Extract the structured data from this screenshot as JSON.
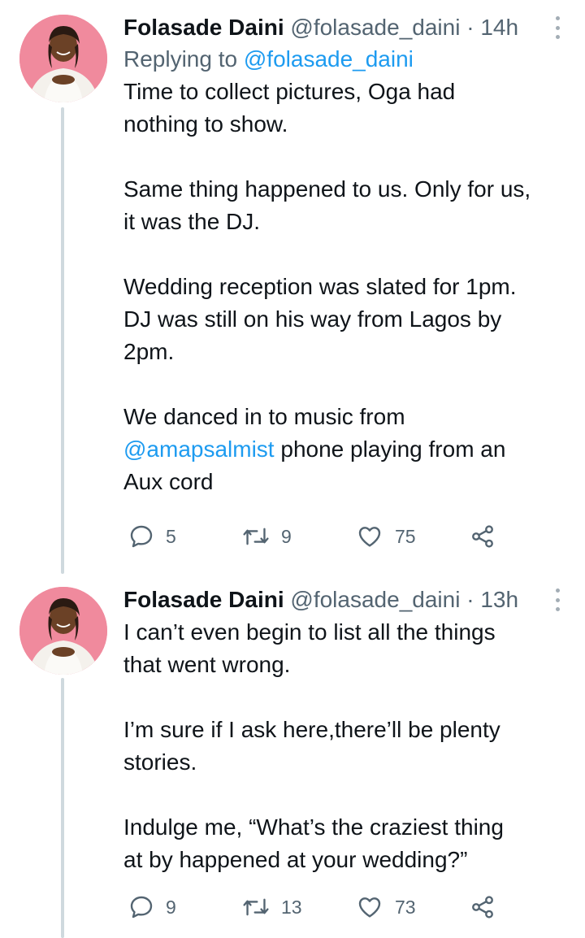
{
  "colors": {
    "link": "#1d9bf0",
    "secondary_text": "#536471",
    "thread_line": "#cfd9de",
    "avatar_bg": "#f08a9d"
  },
  "tweets": [
    {
      "name": "Folasade Daini",
      "handle": "@folasade_daini",
      "separator": "·",
      "time": "14h",
      "replying_prefix": "Replying to ",
      "replying_handle": "@folasade_daini",
      "lines": {
        "l1": "Time to collect pictures, Oga had",
        "l2": "nothing to show.",
        "l3": "Same thing happened to us. Only for us,",
        "l4": "it was the DJ.",
        "l5": "Wedding reception was slated for 1pm.",
        "l6": "DJ was still on his way from Lagos by",
        "l7": "2pm.",
        "l8": "We danced in to music from",
        "l9_mention": "@amapsalmist",
        "l9_rest": " phone playing from an",
        "l10": "Aux cord"
      },
      "reply_count": "5",
      "retweet_count": "9",
      "like_count": "75",
      "icons": [
        "reply-icon",
        "retweet-icon",
        "like-icon",
        "share-icon",
        "more-icon"
      ]
    },
    {
      "name": "Folasade Daini",
      "handle": "@folasade_daini",
      "separator": "·",
      "time": "13h",
      "lines": {
        "l1": "I can’t even begin to list all the things",
        "l2": "that went wrong.",
        "l3": "I’m sure if I ask here,there’ll be plenty",
        "l4": "stories.",
        "l5": "Indulge me, “What’s the craziest thing",
        "l6": "at by happened at your wedding?”"
      },
      "reply_count": "9",
      "retweet_count": "13",
      "like_count": "73",
      "icons": [
        "reply-icon",
        "retweet-icon",
        "like-icon",
        "share-icon",
        "more-icon"
      ]
    }
  ]
}
